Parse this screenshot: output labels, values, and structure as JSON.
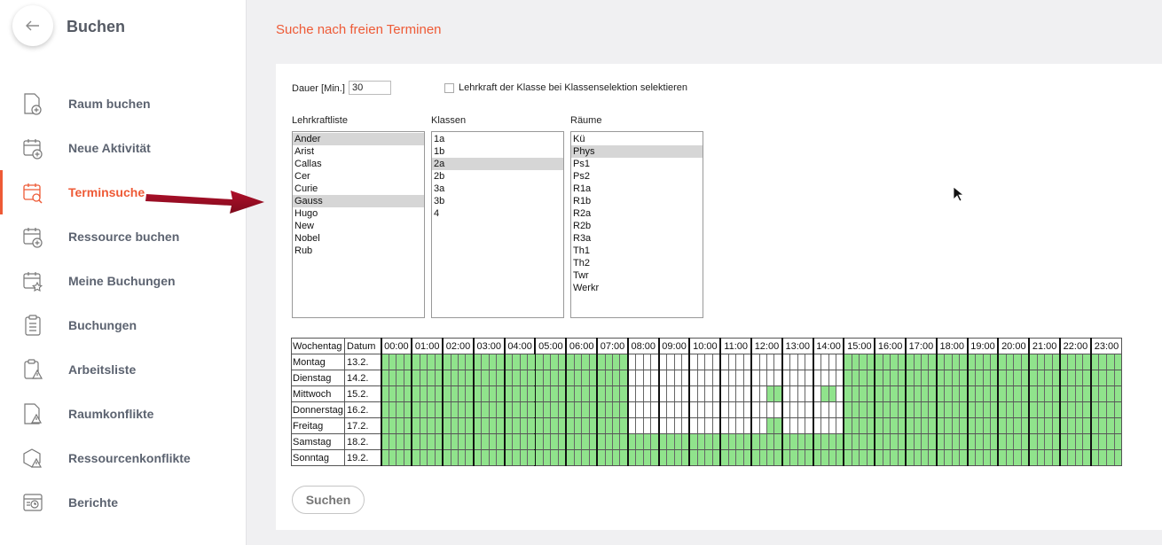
{
  "sidebar": {
    "title": "Buchen",
    "back_icon": "arrow-left-icon",
    "items": [
      {
        "label": "Raum buchen",
        "icon": "page-plus-icon",
        "active": false
      },
      {
        "label": "Neue Aktivität",
        "icon": "calendar-plus-icon",
        "active": false
      },
      {
        "label": "Terminsuche",
        "icon": "calendar-search-icon",
        "active": true
      },
      {
        "label": "Ressource buchen",
        "icon": "calendar-plus-icon",
        "active": false
      },
      {
        "label": "Meine Buchungen",
        "icon": "calendar-star-icon",
        "active": false
      },
      {
        "label": "Buchungen",
        "icon": "clipboard-list-icon",
        "active": false
      },
      {
        "label": "Arbeitsliste",
        "icon": "clipboard-warning-icon",
        "active": false
      },
      {
        "label": "Raumkonflikte",
        "icon": "page-warning-icon",
        "active": false
      },
      {
        "label": "Ressourcenkonflikte",
        "icon": "box-warning-icon",
        "active": false
      },
      {
        "label": "Berichte",
        "icon": "report-clock-icon",
        "active": false
      }
    ]
  },
  "main": {
    "title": "Suche nach freien Terminen",
    "duration_label": "Dauer [Min.]",
    "duration_value": "30",
    "checkbox_label": "Lehrkraft der Klasse bei Klassenselektion selektieren",
    "checkbox_checked": false,
    "search_button": "Suchen"
  },
  "lists": {
    "teachers": {
      "title": "Lehrkraftliste",
      "items": [
        "Ander",
        "Arist",
        "Callas",
        "Cer",
        "Curie",
        "Gauss",
        "Hugo",
        "New",
        "Nobel",
        "Rub"
      ],
      "selected": [
        "Ander",
        "Gauss"
      ]
    },
    "classes": {
      "title": "Klassen",
      "items": [
        "1a",
        "1b",
        "2a",
        "2b",
        "3a",
        "3b",
        "4"
      ],
      "selected": [
        "2a"
      ]
    },
    "rooms": {
      "title": "Räume",
      "items": [
        "Kü",
        "Phys",
        "Ps1",
        "Ps2",
        "R1a",
        "R1b",
        "R2a",
        "R2b",
        "R3a",
        "Th1",
        "Th2",
        "Twr",
        "Werkr"
      ],
      "selected": [
        "Phys"
      ]
    }
  },
  "grid": {
    "col_weekday": "Wochentag",
    "col_date": "Datum",
    "hours": [
      "00:00",
      "01:00",
      "02:00",
      "03:00",
      "04:00",
      "05:00",
      "06:00",
      "07:00",
      "08:00",
      "09:00",
      "10:00",
      "11:00",
      "12:00",
      "13:00",
      "14:00",
      "15:00",
      "16:00",
      "17:00",
      "18:00",
      "19:00",
      "20:00",
      "21:00",
      "22:00",
      "23:00"
    ],
    "free_color": "#90e38c",
    "rows": [
      {
        "day": "Montag",
        "date": "13.2.",
        "free": [
          "0-31",
          "60-95"
        ]
      },
      {
        "day": "Dienstag",
        "date": "14.2.",
        "free": [
          "0-31",
          "60-95"
        ]
      },
      {
        "day": "Mittwoch",
        "date": "15.2.",
        "free": [
          "0-31",
          "50-51",
          "57-58",
          "60-95"
        ]
      },
      {
        "day": "Donnerstag",
        "date": "16.2.",
        "free": [
          "0-31",
          "60-95"
        ]
      },
      {
        "day": "Freitag",
        "date": "17.2.",
        "free": [
          "0-31",
          "50-51",
          "60-95"
        ]
      },
      {
        "day": "Samstag",
        "date": "18.2.",
        "free": [
          "0-95"
        ]
      },
      {
        "day": "Sonntag",
        "date": "19.2.",
        "free": [
          "0-95"
        ]
      }
    ]
  }
}
